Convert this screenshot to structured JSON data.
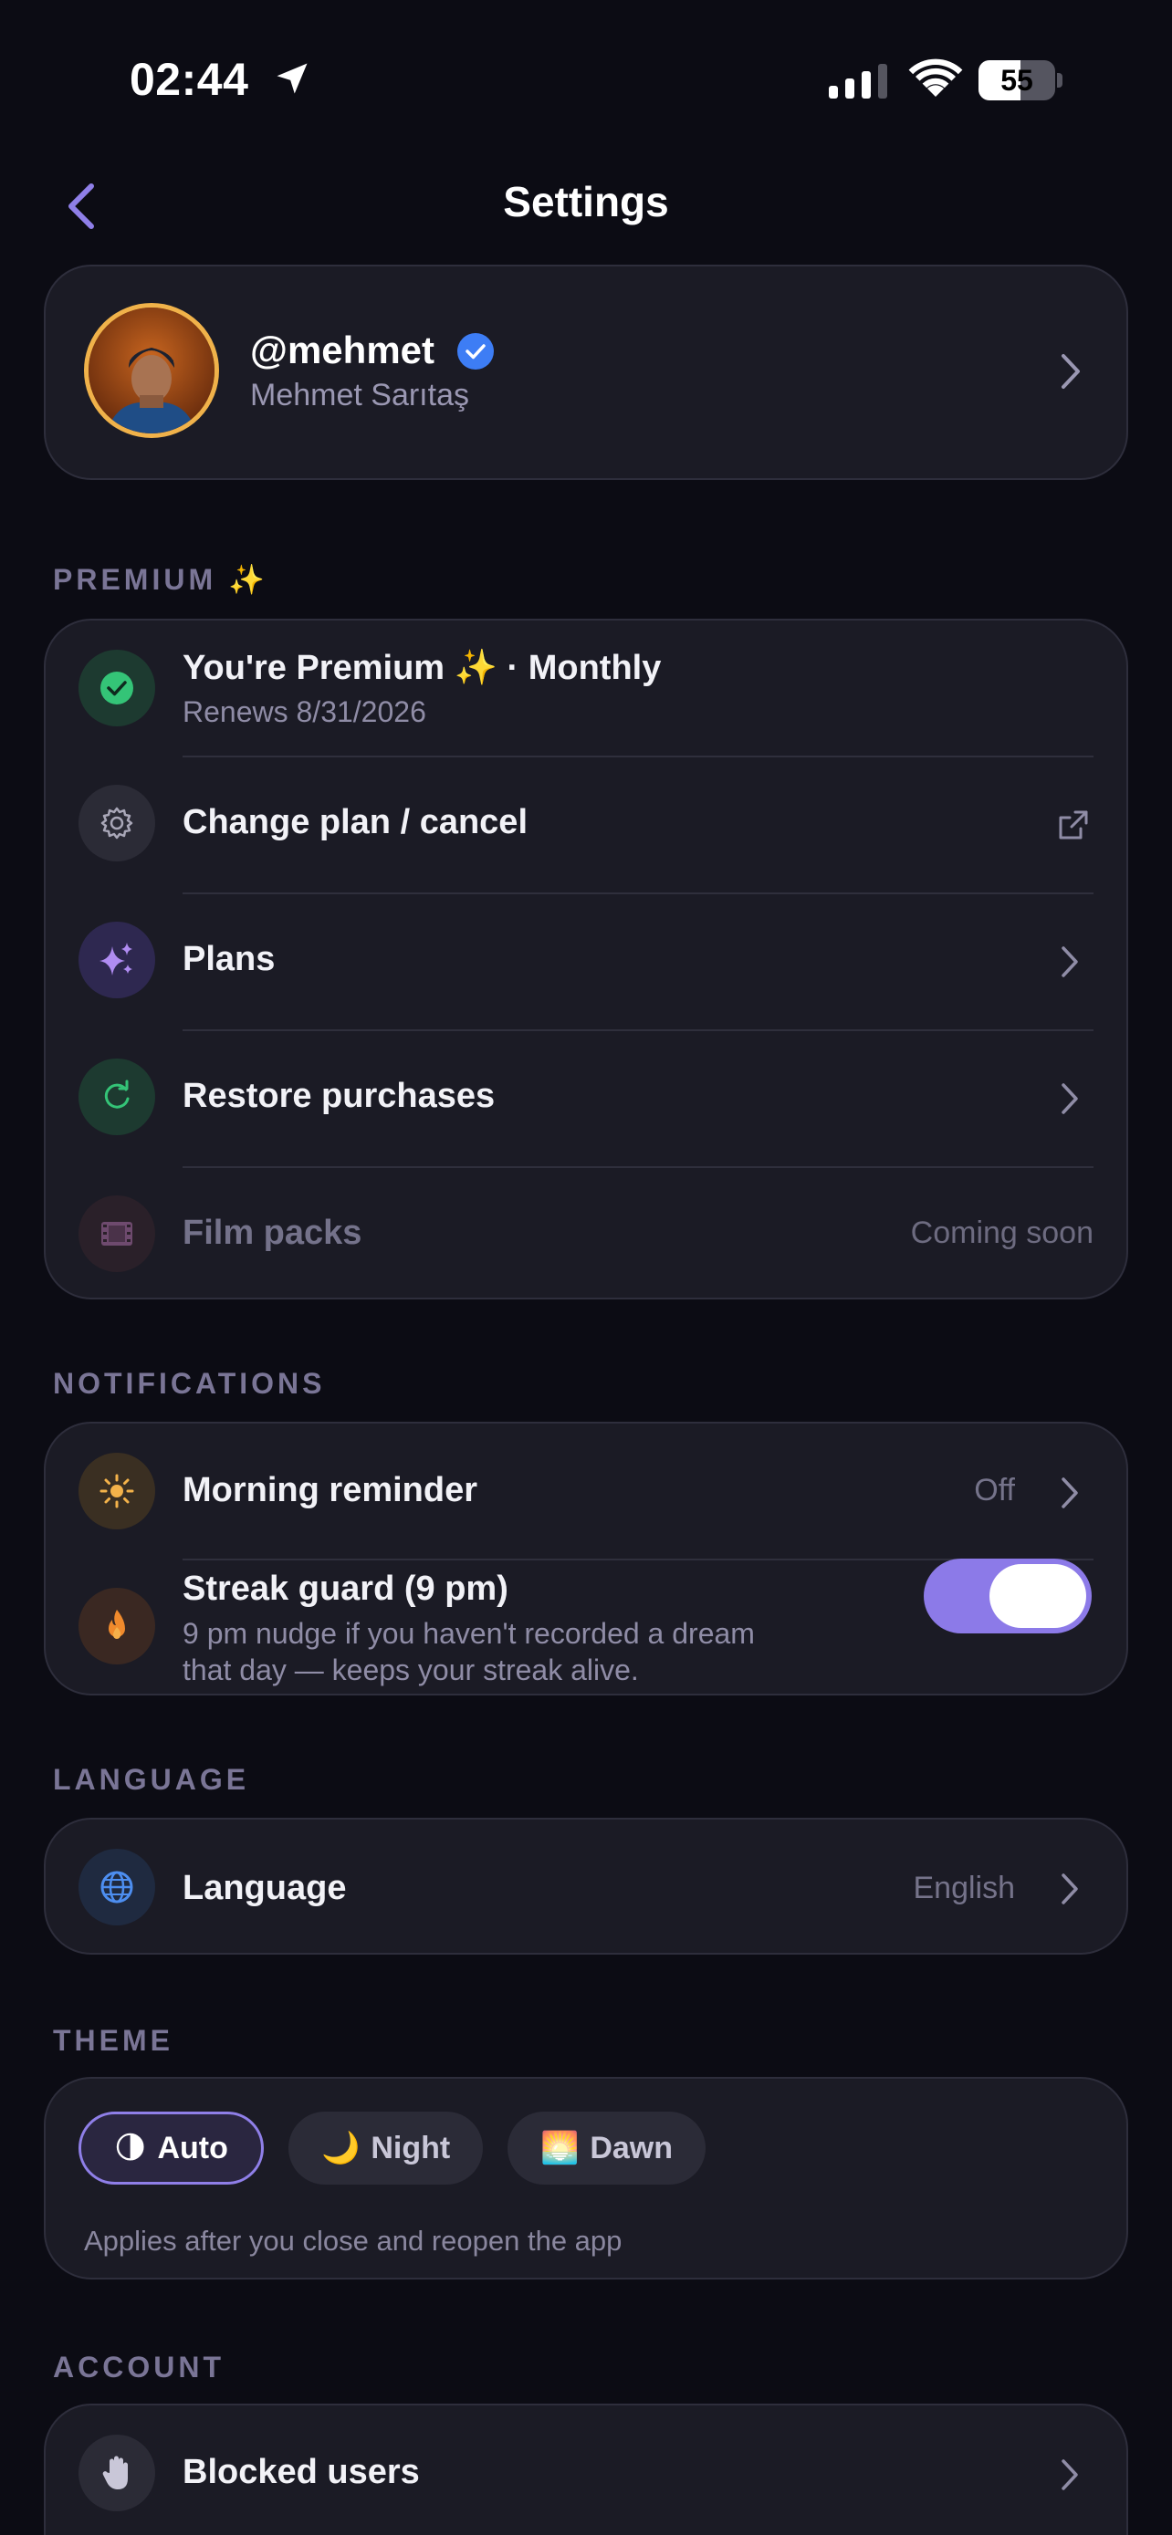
{
  "status_bar": {
    "time": "02:44",
    "battery_level": "55",
    "battery_fraction": 0.55
  },
  "header": {
    "title": "Settings"
  },
  "profile": {
    "handle": "@mehmet",
    "name": "Mehmet Sarıtaş"
  },
  "premium": {
    "label": "PREMIUM ✨",
    "status_title": "You're Premium ✨ · Monthly",
    "status_sub": "Renews 8/31/2026",
    "change_plan": "Change plan / cancel",
    "plans": "Plans",
    "restore": "Restore purchases",
    "film_packs": "Film packs",
    "film_packs_value": "Coming soon"
  },
  "notifications": {
    "label": "NOTIFICATIONS",
    "morning_title": "Morning reminder",
    "morning_value": "Off",
    "streak_title": "Streak guard (9 pm)",
    "streak_sub_line1": "9 pm nudge if you haven't recorded a dream",
    "streak_sub_line2": "that day — keeps your streak alive.",
    "streak_enabled": true
  },
  "language": {
    "label": "LANGUAGE",
    "title": "Language",
    "value": "English"
  },
  "theme": {
    "label": "THEME",
    "options": [
      {
        "emoji": "🌗",
        "label": "Auto",
        "selected": true
      },
      {
        "emoji": "🌙",
        "label": "Night",
        "selected": false
      },
      {
        "emoji": "🌅",
        "label": "Dawn",
        "selected": false
      }
    ],
    "note": "Applies after you close and reopen the app"
  },
  "account": {
    "label": "ACCOUNT",
    "blocked": "Blocked users"
  },
  "colors": {
    "background": "#0c0c14",
    "card": "#1b1b25",
    "accent": "#8c7ae8",
    "verified": "#3d7df5",
    "success": "#34c477"
  }
}
